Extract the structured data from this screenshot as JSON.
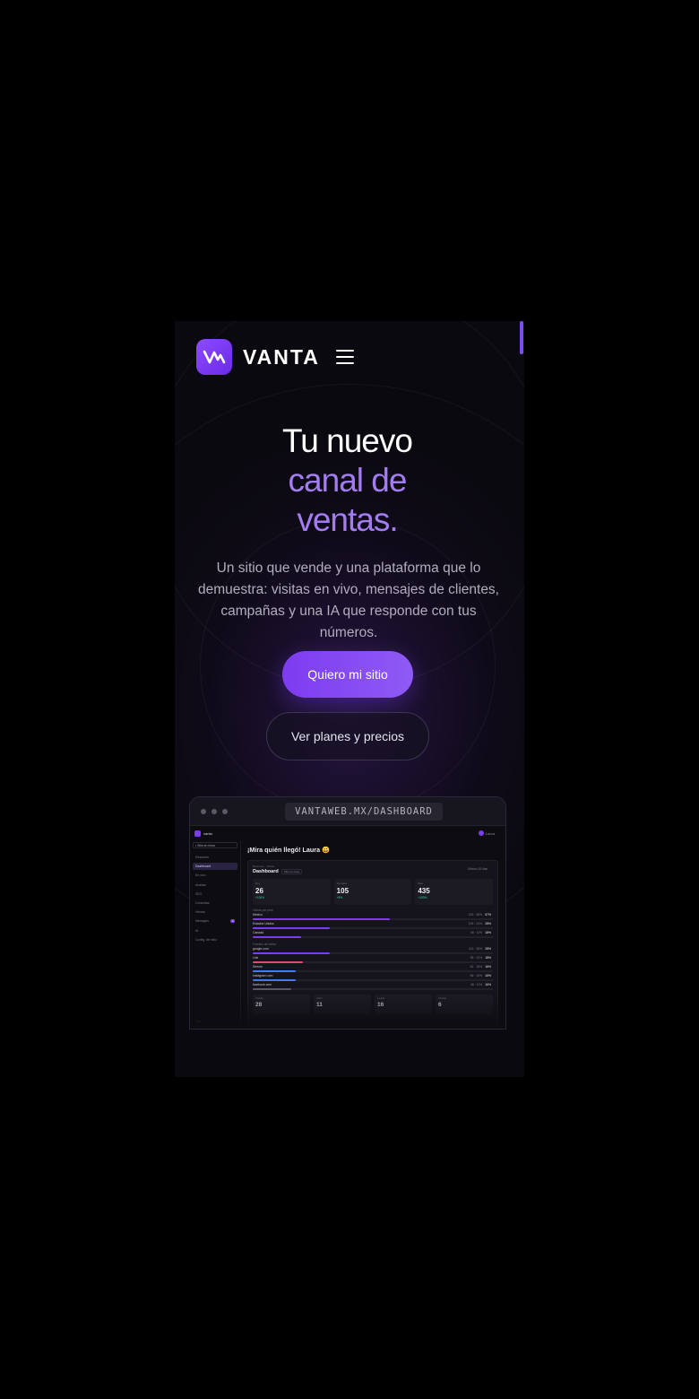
{
  "brand": {
    "name": "VANTA"
  },
  "hero": {
    "title_line1": "Tu nuevo",
    "title_line2": "canal de",
    "title_line3": "ventas.",
    "subtitle": "Un sitio que vende y una plataforma que lo demuestra: visitas en vivo, mensajes de clientes, campañas y una IA que responde con tus números.",
    "primary_cta": "Quiero mi sitio",
    "secondary_cta": "Ver planes y precios"
  },
  "browser": {
    "url": "VANTAWEB.MX/DASHBOARD"
  },
  "dashboard": {
    "brand": "vanta",
    "user": "Laura",
    "site_selector": "• Sitio en línea",
    "nav": [
      {
        "label": "Resumen"
      },
      {
        "label": "Dashboard",
        "active": true
      },
      {
        "label": "En vivo"
      },
      {
        "label": "Análisis"
      },
      {
        "label": "SEO"
      },
      {
        "label": "Consultas"
      },
      {
        "label": "Ventas"
      },
      {
        "label": "Mensajes",
        "count": "3"
      },
      {
        "label": "IA"
      },
      {
        "label": "Config. del sitio"
      }
    ],
    "logout": "Salir",
    "greeting": "¡Mira quién llegó! Laura 😀",
    "crumb": "Resumen · Visitas",
    "panel_title": "Dashboard",
    "panel_tag": "Sitio en línea",
    "period": "Últimos 30 días",
    "kpis": [
      {
        "label": "Hoy",
        "value": "26",
        "change": "+100%"
      },
      {
        "label": "Semana",
        "value": "105",
        "change": "+8%"
      },
      {
        "label": "Mes",
        "value": "435",
        "change": "+100%"
      }
    ],
    "countries_title": "Visitas por país",
    "countries": [
      {
        "name": "México",
        "value": "253 · 58%",
        "pct": "57%",
        "fill": 0.57,
        "color": "#7d3cf0"
      },
      {
        "name": "Estados Unidos",
        "value": "105 · 24%",
        "pct": "28%",
        "fill": 0.32,
        "color": "#7d3cf0"
      },
      {
        "name": "Canadá",
        "value": "48 · 11%",
        "pct": "18%",
        "fill": 0.2,
        "color": "#7d3cf0"
      }
    ],
    "sources_title": "Fuentes de tráfico",
    "sources": [
      {
        "name": "google.com",
        "value": "142 · 35%",
        "pct": "28%",
        "fill": 0.32,
        "color": "#7d3cf0"
      },
      {
        "name": "Link",
        "value": "98 · 22%",
        "pct": "18%",
        "fill": 0.21,
        "color": "#e04a6e"
      },
      {
        "name": "Directo",
        "value": "81 · 18%",
        "pct": "16%",
        "fill": 0.18,
        "color": "#3d7df0"
      },
      {
        "name": "Instagram.com",
        "value": "66 · 15%",
        "pct": "16%",
        "fill": 0.18,
        "color": "#3d7df0"
      },
      {
        "name": "facebook.com",
        "value": "48 · 11%",
        "pct": "16%",
        "fill": 0.16,
        "color": "#5a5866"
      }
    ],
    "bottom_cards": [
      {
        "label": "Visitas",
        "value": "28"
      },
      {
        "label": "Clics",
        "value": "11"
      },
      {
        "label": "Leads",
        "value": "16"
      },
      {
        "label": "Ventas",
        "value": "6"
      }
    ]
  }
}
